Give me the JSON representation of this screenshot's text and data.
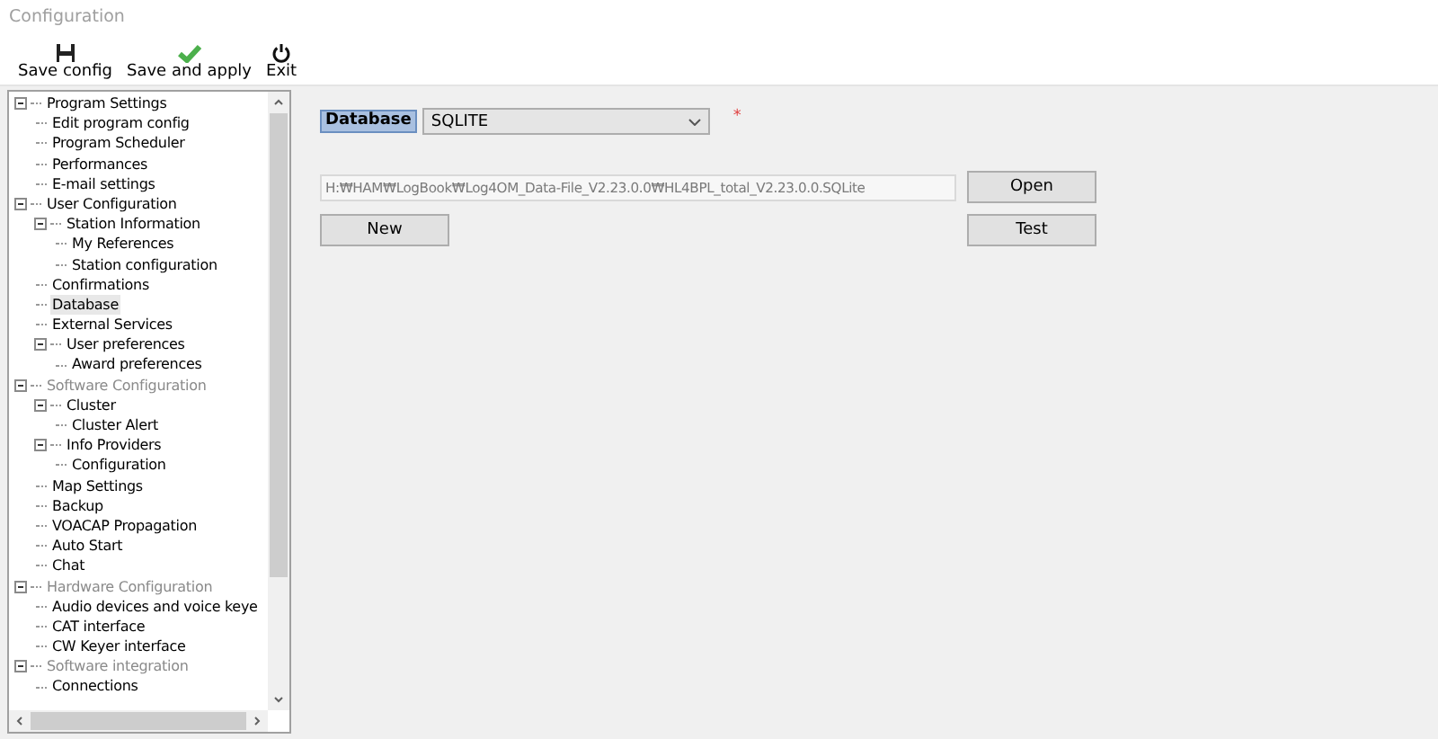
{
  "window": {
    "title": "Configuration"
  },
  "toolbar": [
    {
      "label": "Save config",
      "kind": "save"
    },
    {
      "label": "Save and apply",
      "kind": "apply"
    },
    {
      "label": "Exit",
      "kind": "exit"
    }
  ],
  "tree": [
    {
      "label": "Program Settings",
      "expanded": true,
      "disabled": false,
      "selected": false,
      "children": [
        {
          "label": "Edit program config",
          "selected": false
        },
        {
          "label": "Program Scheduler",
          "selected": false
        },
        {
          "label": "Performances",
          "selected": false
        },
        {
          "label": "E-mail settings",
          "selected": false
        }
      ]
    },
    {
      "label": "User Configuration",
      "expanded": true,
      "disabled": false,
      "selected": false,
      "children": [
        {
          "label": "Station Information",
          "expanded": true,
          "selected": false,
          "children": [
            {
              "label": "My References",
              "selected": false
            },
            {
              "label": "Station configuration",
              "selected": false
            }
          ]
        },
        {
          "label": "Confirmations",
          "selected": false
        },
        {
          "label": "Database",
          "selected": true
        },
        {
          "label": "External Services",
          "selected": false
        },
        {
          "label": "User preferences",
          "expanded": true,
          "selected": false,
          "children": [
            {
              "label": "Award preferences",
              "selected": false
            }
          ]
        }
      ]
    },
    {
      "label": "Software Configuration",
      "expanded": true,
      "disabled": true,
      "selected": false,
      "children": [
        {
          "label": "Cluster",
          "expanded": true,
          "selected": false,
          "children": [
            {
              "label": "Cluster Alert",
              "selected": false
            }
          ]
        },
        {
          "label": "Info Providers",
          "expanded": true,
          "selected": false,
          "children": [
            {
              "label": "Configuration",
              "selected": false
            }
          ]
        },
        {
          "label": "Map Settings",
          "selected": false
        },
        {
          "label": "Backup",
          "selected": false
        },
        {
          "label": "VOACAP Propagation",
          "selected": false
        },
        {
          "label": "Auto Start",
          "selected": false
        },
        {
          "label": "Chat",
          "selected": false
        }
      ]
    },
    {
      "label": "Hardware Configuration",
      "expanded": true,
      "disabled": true,
      "selected": false,
      "children": [
        {
          "label": "Audio devices and voice keye",
          "selected": false
        },
        {
          "label": "CAT interface",
          "selected": false
        },
        {
          "label": "CW Keyer interface",
          "selected": false
        }
      ]
    },
    {
      "label": "Software integration",
      "expanded": true,
      "disabled": true,
      "selected": false,
      "children": [
        {
          "label": "Connections",
          "selected": false
        }
      ]
    }
  ],
  "form": {
    "database_label": "Database",
    "database_value": "SQLITE",
    "required_mark": "*",
    "path": "H:₩HAM₩LogBook₩Log4OM_Data-File_V2.23.0.0₩HL4BPL_total_V2.23.0.0.SQLite",
    "open_button": "Open",
    "new_button": "New",
    "test_button": "Test"
  }
}
